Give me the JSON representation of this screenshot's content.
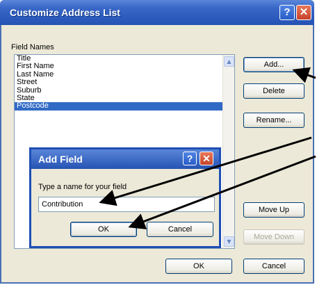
{
  "window": {
    "title": "Customize Address List",
    "help_glyph": "?",
    "close_glyph": "✕"
  },
  "field_names_label": "Field Names",
  "fields": [
    "Title",
    "First Name",
    "Last Name",
    "Street",
    "Suburb",
    "State",
    "Postcode"
  ],
  "selected_field": "Postcode",
  "buttons": {
    "add": "Add...",
    "delete": "Delete",
    "rename": "Rename...",
    "move_up": "Move Up",
    "move_down": "Move Down",
    "ok": "OK",
    "cancel": "Cancel"
  },
  "add_field_dialog": {
    "title": "Add Field",
    "help_glyph": "?",
    "close_glyph": "✕",
    "prompt": "Type a name for your field",
    "value": "Contribution",
    "ok": "OK",
    "cancel": "Cancel"
  },
  "colors": {
    "titlebar": "#2b5bbd",
    "selection": "#316ac5",
    "dialog_face": "#ece9d8",
    "close_button": "#c6432a"
  }
}
